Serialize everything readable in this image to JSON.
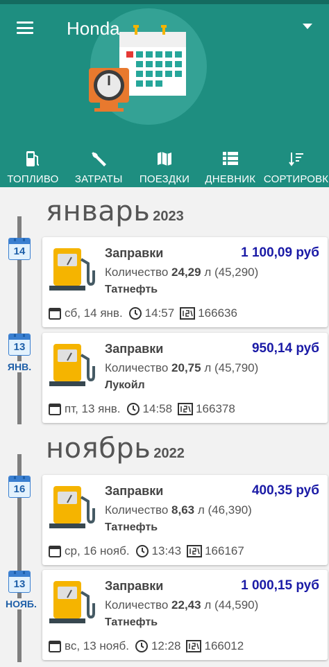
{
  "app": {
    "title": "Honda"
  },
  "tabs": [
    {
      "label": "ТОПЛИВО",
      "icon": "fuel-pump-icon"
    },
    {
      "label": "ЗАТРАТЫ",
      "icon": "wrench-icon"
    },
    {
      "label": "ПОЕЗДКИ",
      "icon": "map-icon"
    },
    {
      "label": "ДНЕВНИК",
      "icon": "list-icon"
    },
    {
      "label": "СОРТИРОВК",
      "icon": "sort-icon"
    }
  ],
  "months": [
    {
      "name": "январь",
      "year": "2023"
    },
    {
      "name": "ноябрь",
      "year": "2022"
    }
  ],
  "entries": [
    {
      "day": "14",
      "month_label": "",
      "title": "Заправки",
      "amount": "1 100,09 руб",
      "qty_label": "Количество",
      "qty": "24,29",
      "qty_rest": "л (45,290)",
      "station": "Татнефть",
      "date": "сб, 14 янв.",
      "time": "14:57",
      "odometer": "166636"
    },
    {
      "day": "13",
      "month_label": "ЯНВ.",
      "title": "Заправки",
      "amount": "950,14 руб",
      "qty_label": "Количество",
      "qty": "20,75",
      "qty_rest": "л (45,790)",
      "station": "Лукойл",
      "date": "пт, 13 янв.",
      "time": "14:58",
      "odometer": "166378"
    },
    {
      "day": "16",
      "month_label": "",
      "title": "Заправки",
      "amount": "400,35 руб",
      "qty_label": "Количество",
      "qty": "8,63",
      "qty_rest": "л (46,390)",
      "station": "Татнефть",
      "date": "ср, 16 нояб.",
      "time": "13:43",
      "odometer": "166167"
    },
    {
      "day": "13",
      "month_label": "НОЯБ.",
      "title": "Заправки",
      "amount": "1 000,15 руб",
      "qty_label": "Количество",
      "qty": "22,43",
      "qty_rest": "л (44,590)",
      "station": "Татнефть",
      "date": "вс, 13 нояб.",
      "time": "12:28",
      "odometer": "166012"
    }
  ],
  "colors": {
    "header": "#1e8e80",
    "amount": "#1a1aa6",
    "calendar": "#3a7fd0",
    "timeline": "#7f7f7f"
  }
}
